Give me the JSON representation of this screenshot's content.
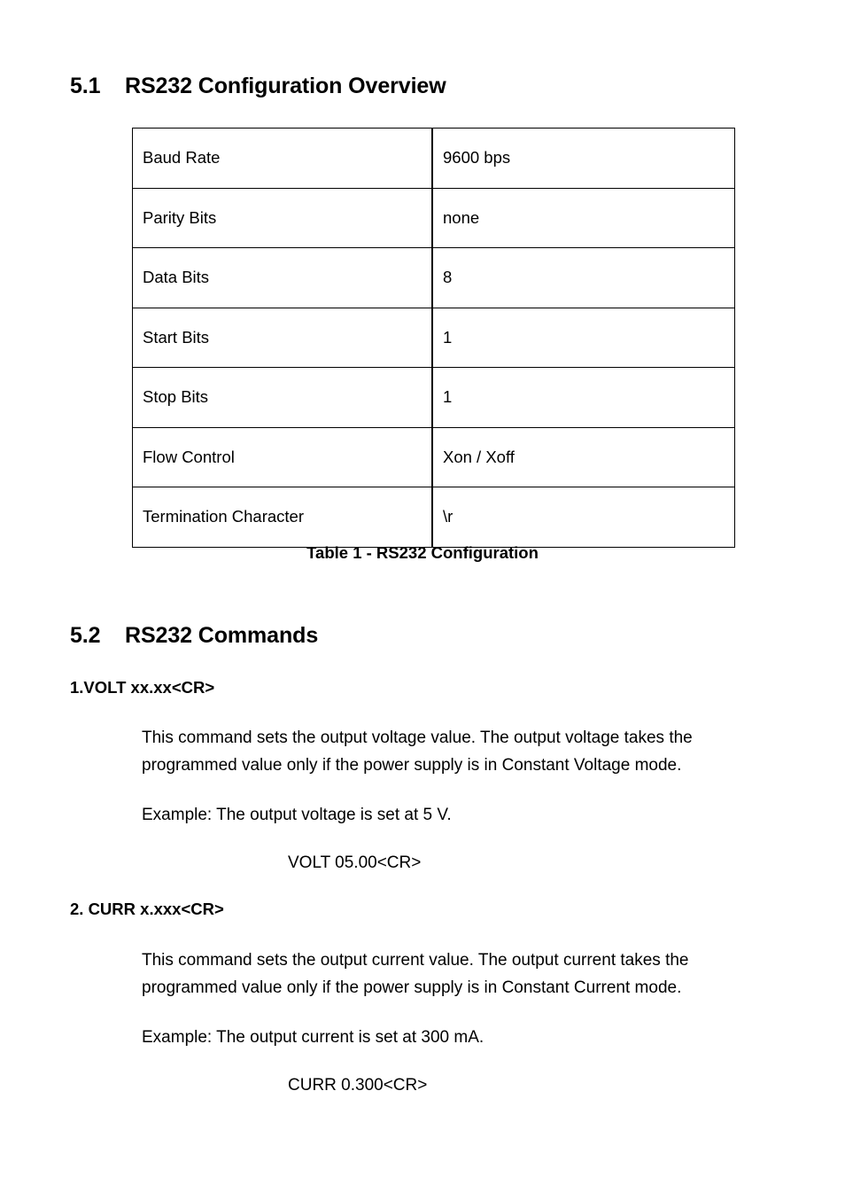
{
  "sections": {
    "rs232_overview": {
      "number": "5.1",
      "title": "RS232 Configuration Overview"
    },
    "rs232_commands": {
      "number": "5.2",
      "title": "RS232 Commands"
    }
  },
  "config_table": {
    "caption": "Table 1 - RS232 Configuration",
    "rows": [
      {
        "parameter": "Baud Rate",
        "value": "9600 bps"
      },
      {
        "parameter": "Parity Bits",
        "value": "none"
      },
      {
        "parameter": "Data Bits",
        "value": "8"
      },
      {
        "parameter": "Start Bits",
        "value": "1"
      },
      {
        "parameter": "Stop Bits",
        "value": "1"
      },
      {
        "parameter": "Flow Control",
        "value": "Xon / Xoff"
      },
      {
        "parameter": "Termination Character",
        "value": "\\r"
      }
    ]
  },
  "commands": [
    {
      "title": "1.VOLT xx.xx<CR>",
      "description": "This command sets the output voltage value. The output voltage takes the programmed value only if the power supply is in Constant Voltage mode.",
      "example_text": "Example: The output voltage is set at 5 V.",
      "example_command": "VOLT 05.00<CR>"
    },
    {
      "title": "2. CURR x.xxx<CR>",
      "description": "This command sets the output current value. The output current takes the programmed value only if the power supply is in Constant Current mode.",
      "example_text": "Example: The output current is set at 300 mA.",
      "example_command": "CURR 0.300<CR>"
    }
  ],
  "colors": {
    "text": "#000000",
    "page_background": "#ffffff",
    "table_border": "#000000"
  }
}
